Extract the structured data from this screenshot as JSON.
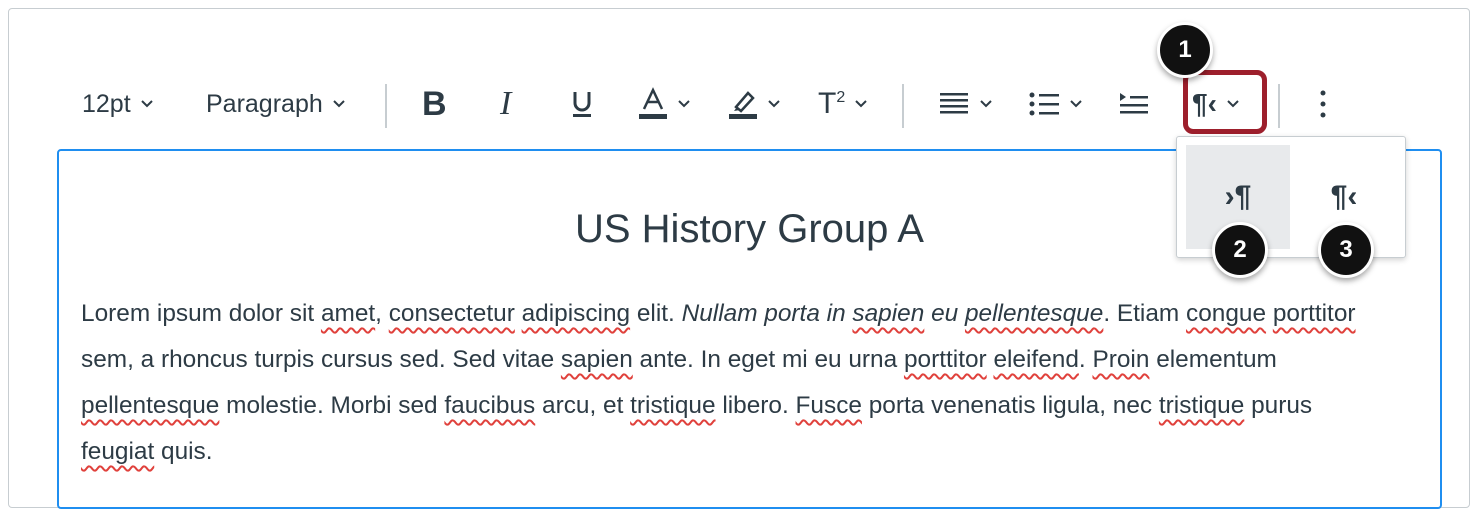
{
  "toolbar": {
    "font_size": "12pt",
    "block_format": "Paragraph",
    "bold_icon": "bold-icon",
    "italic_icon": "italic-icon",
    "underline_icon": "underline-icon",
    "text_color_icon": "text-color-icon",
    "highlight_icon": "highlight-icon",
    "superscript_icon": "superscript-icon",
    "align_icon": "align-icon",
    "list_icon": "bullet-list-icon",
    "indent_icon": "indent-icon",
    "direction_icon": "text-direction-icon",
    "more_icon": "more-vertical-icon"
  },
  "direction_menu": {
    "ltr_icon": "left-to-right-icon",
    "rtl_icon": "right-to-left-icon"
  },
  "editor": {
    "title": "US History Group A",
    "paragraph": [
      {
        "text": "Lorem ipsum dolor sit ",
        "style": "normal"
      },
      {
        "text": "amet",
        "style": "spell"
      },
      {
        "text": ", ",
        "style": "normal"
      },
      {
        "text": "consectetur",
        "style": "spell"
      },
      {
        "text": " ",
        "style": "normal"
      },
      {
        "text": "adipiscing",
        "style": "spell"
      },
      {
        "text": " elit. ",
        "style": "normal"
      },
      {
        "text": "Nullam porta in ",
        "style": "italic"
      },
      {
        "text": "sapien",
        "style": "italic-spell"
      },
      {
        "text": " eu ",
        "style": "italic"
      },
      {
        "text": "pellentesque",
        "style": "italic-spell"
      },
      {
        "text": ". Etiam ",
        "style": "normal"
      },
      {
        "text": "congue",
        "style": "spell"
      },
      {
        "text": " ",
        "style": "normal"
      },
      {
        "text": "porttitor",
        "style": "spell"
      },
      {
        "text": " sem, a rhoncus turpis cursus sed. Sed vitae ",
        "style": "normal"
      },
      {
        "text": "sapien",
        "style": "spell"
      },
      {
        "text": " ante. In eget mi eu urna ",
        "style": "normal"
      },
      {
        "text": "porttitor",
        "style": "spell"
      },
      {
        "text": " ",
        "style": "normal"
      },
      {
        "text": "eleifend",
        "style": "spell"
      },
      {
        "text": ". ",
        "style": "normal"
      },
      {
        "text": "Proin",
        "style": "spell"
      },
      {
        "text": " elementum ",
        "style": "normal"
      },
      {
        "text": "pellentesque",
        "style": "spell"
      },
      {
        "text": " molestie. Morbi sed ",
        "style": "normal"
      },
      {
        "text": "faucibus",
        "style": "spell"
      },
      {
        "text": " arcu, et ",
        "style": "normal"
      },
      {
        "text": "tristique",
        "style": "spell"
      },
      {
        "text": " libero. ",
        "style": "normal"
      },
      {
        "text": "Fusce",
        "style": "spell"
      },
      {
        "text": " porta venenatis ligula, nec ",
        "style": "normal"
      },
      {
        "text": "tristique",
        "style": "spell"
      },
      {
        "text": " purus ",
        "style": "normal"
      },
      {
        "text": "feugiat",
        "style": "spell"
      },
      {
        "text": " quis.",
        "style": "normal"
      }
    ]
  },
  "callouts": {
    "one": "1",
    "two": "2",
    "three": "3"
  },
  "colors": {
    "callout_border": "#9d1f2c",
    "editor_focus": "#1f8ef0",
    "spellcheck": "#e0413c"
  }
}
